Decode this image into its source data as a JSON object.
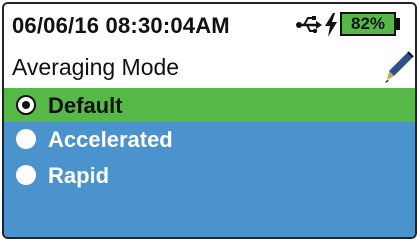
{
  "status": {
    "datetime": "06/06/16  08:30:04AM",
    "battery_text": "82%",
    "battery_level": 0.82,
    "icons": [
      "usb-icon",
      "charging-bolt-icon",
      "battery-icon"
    ]
  },
  "header": {
    "title": "Averaging Mode",
    "icon": "pen-icon"
  },
  "options": [
    {
      "label": "Default",
      "selected": true
    },
    {
      "label": "Accelerated",
      "selected": false
    },
    {
      "label": "Rapid",
      "selected": false
    }
  ],
  "colors": {
    "selected": "#56b947",
    "list_background": "#4b93cc",
    "battery_fill": "#56b947"
  }
}
